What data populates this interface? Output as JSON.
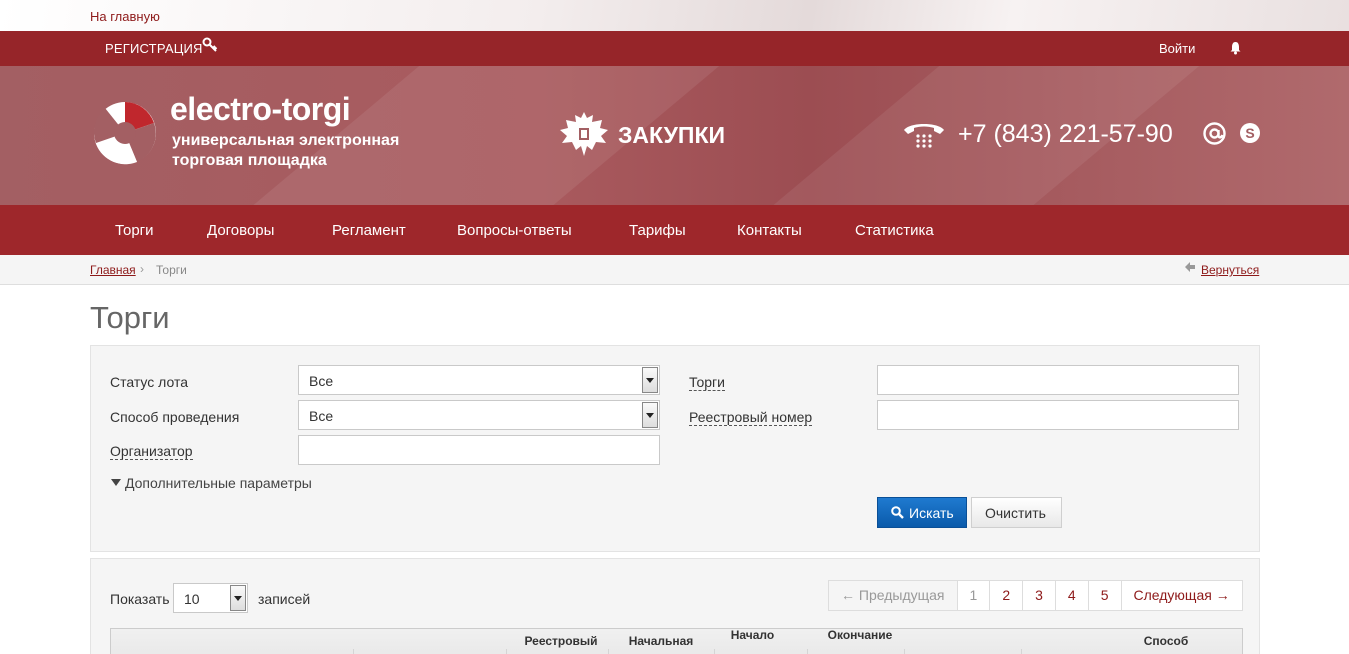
{
  "top": {
    "home_link": "На главную"
  },
  "userbar": {
    "register": "РЕГИСТРАЦИЯ",
    "login": "Войти"
  },
  "header": {
    "logo_title": "electro-torgi",
    "logo_sub1": "универсальная электронная",
    "logo_sub2": "торговая площадка",
    "section": "ЗАКУПКИ",
    "phone": "+7 (843) 221-57-90"
  },
  "nav": {
    "items": [
      "Торги",
      "Договоры",
      "Регламент",
      "Вопросы-ответы",
      "Тарифы",
      "Контакты",
      "Статистика"
    ]
  },
  "breadcrumb": {
    "home": "Главная",
    "sep": "›",
    "current": "Торги",
    "back": "Вернуться"
  },
  "page": {
    "title": "Торги"
  },
  "filters": {
    "lot_status_label": "Статус лота",
    "lot_status_value": "Все",
    "method_label": "Способ проведения",
    "method_value": "Все",
    "organizer_label": "Организатор",
    "organizer_value": "",
    "torgi_label": "Торги",
    "torgi_value": "",
    "reg_number_label": "Реестровый номер",
    "reg_number_value": "",
    "more_params": "Дополнительные параметры",
    "search_button": "Искать",
    "clear_button": "Очистить"
  },
  "table": {
    "show_label": "Показать",
    "page_size": "10",
    "records_label": "записей",
    "pager": {
      "prev": "← Предыдущая",
      "pages": [
        "1",
        "2",
        "3",
        "4",
        "5"
      ],
      "current_page": "1",
      "next": "Следующая →"
    },
    "columns": [
      {
        "line1": "Реестровый",
        "line2": ""
      },
      {
        "line1": "Начальная",
        "line2": ""
      },
      {
        "line1": "Начало",
        "line2": ""
      },
      {
        "line1": "Окончание",
        "line2": ""
      },
      {
        "line1": "Способ",
        "line2": ""
      }
    ]
  },
  "colors": {
    "brand_red": "#9e272b",
    "link_red": "#8e1a1a",
    "search_blue": "#0a5aaa"
  }
}
